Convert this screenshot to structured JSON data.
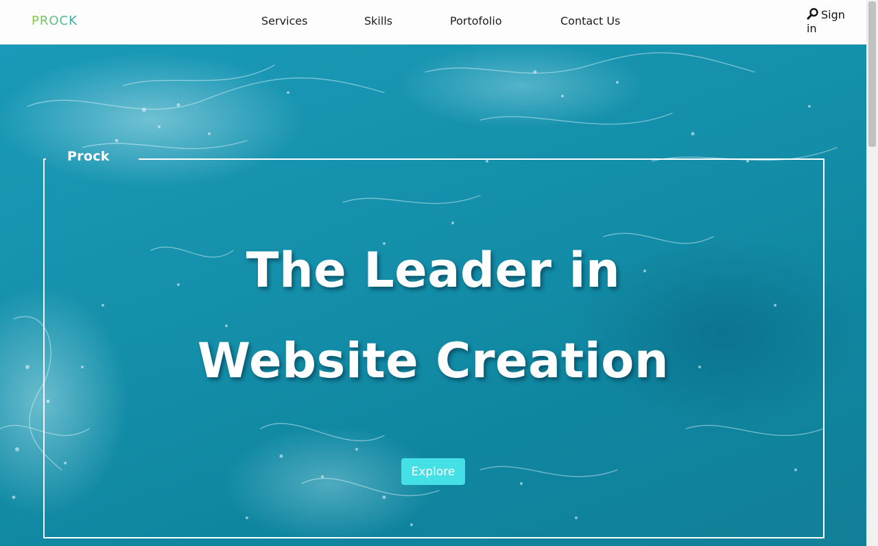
{
  "header": {
    "logo": "PROCK",
    "nav": [
      {
        "label": "Services"
      },
      {
        "label": "Skills"
      },
      {
        "label": "Portofolio"
      },
      {
        "label": "Contact Us"
      }
    ],
    "signin_label": "Sign in",
    "search_icon": "search-icon"
  },
  "hero": {
    "frame_label": "Prock",
    "headline_line1": "The Leader in",
    "headline_line2": "Website Creation",
    "cta_label": "Explore",
    "cta_color": "#45dfe6",
    "background_color": "#1590ab"
  },
  "colors": {
    "logo_gradient_start": "#8cc63f",
    "logo_gradient_end": "#2aa8a8",
    "nav_text": "#1c1c1c",
    "header_bg": "#fdfdfd",
    "hero_text": "#ffffff"
  }
}
